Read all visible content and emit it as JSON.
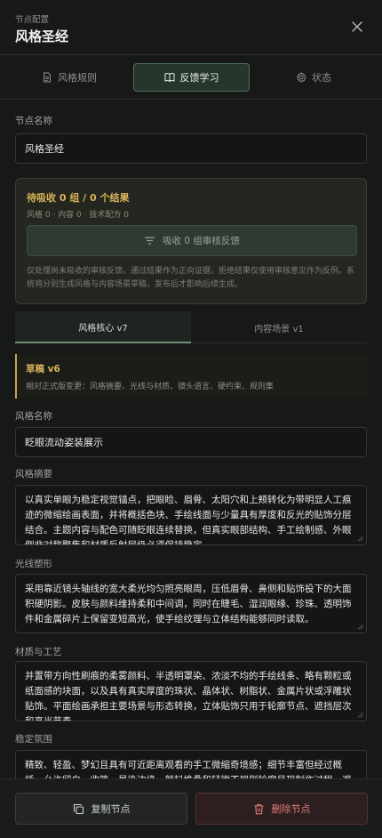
{
  "header": {
    "kicker": "节点配置",
    "title": "风格圣经"
  },
  "tabs": [
    {
      "label": "风格规则",
      "icon": "document-icon"
    },
    {
      "label": "反馈学习",
      "icon": "book-icon",
      "active": true
    },
    {
      "label": "状态",
      "icon": "gear-icon"
    }
  ],
  "node_name": {
    "label": "节点名称",
    "value": "风格圣经"
  },
  "pending": {
    "title": "待吸收 0 组 / 0 个结果",
    "meta": "风格 0 · 内容 0 · 技术配方 0",
    "button_label": "吸收 0 组审核反馈",
    "note": "仅处理尚未吸收的审核反馈。通过结果作为正向证据，拒绝结果仅使用审核意见作为反例。系统将分别生成风格与内容场景草稿，发布后才影响后续生成。"
  },
  "subtabs": [
    {
      "label": "风格核心 v7",
      "active": true
    },
    {
      "label": "内容场景 v1"
    }
  ],
  "draft": {
    "title": "草稿 v6",
    "meta": "相对正式版变更：风格摘要、光线与材质、镜头语言、硬约束、规则集"
  },
  "style_name": {
    "label": "风格名称",
    "value": "眨眼流动姿装展示"
  },
  "style_summary": {
    "label": "风格摘要",
    "value": "以真实单眼为稳定视觉锚点，把眼睑、眉骨、太阳穴和上颊转化为带明显人工痕迹的微缩绘画表面，并将概括色块、手绘线面与少量具有厚度和反光的贴饰分层结合。主题内容与配色可随眨眼连续替换，但真实眼部结构、手工绘制感、外眼侧非对称聚集和材质反射层级必须保持稳定。"
  },
  "lighting": {
    "label": "光线塑形",
    "value": "采用靠近镜头轴线的宽大柔光均匀照亮眼周，压低眉骨、鼻侧和贴饰投下的大面积硬阴影。皮肤与颜料维持柔和中间调，同时在睫毛、湿润眼缘、珍珠、透明饰件和金属碎片上保留变短高光，使手绘纹理与立体结构能够同时读取。"
  },
  "material": {
    "label": "材质与工艺",
    "value": "并置带方向性刷痕的柔雾颜料、半透明罩染、浓淡不均的手绘线条、略有颗粒或纸面感的块面，以及具有真实厚度的珠状、晶体状、树脂状、金属片状或浮雕状贴饰。平面绘画承担主要场景与形态转换，立体贴饰只用于轮廓节点、遮挡层次和高光节奏。"
  },
  "atmosphere": {
    "label": "稳定氛围",
    "value": "精致、轻盈、梦幻且具有可近距离观看的手工微缩奇境感；细节丰富但经过概括，允许留白、收笔、晕染边缘、颜料堆叠和轻微不规则轮廓呈现制作过程，避免整体退向"
  },
  "footer": {
    "copy_label": "复制节点",
    "delete_label": "删除节点"
  },
  "colors": {
    "accent_green": "#6d8f77",
    "pending_gold": "#d8b45a",
    "danger_red": "#e07a7a"
  }
}
